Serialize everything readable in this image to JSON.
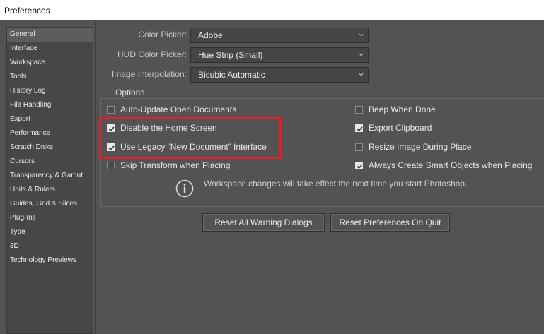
{
  "window": {
    "title": "Preferences"
  },
  "sidebar": {
    "items": [
      {
        "label": "General",
        "active": true
      },
      {
        "label": "Interface"
      },
      {
        "label": "Workspace"
      },
      {
        "label": "Tools"
      },
      {
        "label": "History Log"
      },
      {
        "label": "File Handling"
      },
      {
        "label": "Export"
      },
      {
        "label": "Performance"
      },
      {
        "label": "Scratch Disks"
      },
      {
        "label": "Cursors"
      },
      {
        "label": "Transparency & Gamut"
      },
      {
        "label": "Units & Rulers"
      },
      {
        "label": "Guides, Grid & Slices"
      },
      {
        "label": "Plug-Ins"
      },
      {
        "label": "Type"
      },
      {
        "label": "3D"
      },
      {
        "label": "Technology Previews"
      }
    ]
  },
  "general": {
    "color_picker": {
      "label": "Color Picker:",
      "value": "Adobe"
    },
    "hud_color_picker": {
      "label": "HUD Color Picker:",
      "value": "Hue Strip (Small)"
    },
    "image_interpolation": {
      "label": "Image Interpolation:",
      "value": "Bicubic Automatic"
    }
  },
  "options": {
    "legend": "Options",
    "left": [
      {
        "label": "Auto-Update Open Documents",
        "checked": false
      },
      {
        "label": "Disable the Home Screen",
        "checked": true
      },
      {
        "label": "Use Legacy “New Document” Interface",
        "checked": true
      },
      {
        "label": "Skip Transform when Placing",
        "checked": false
      }
    ],
    "right": [
      {
        "label": "Beep When Done",
        "checked": false
      },
      {
        "label": "Export Clipboard",
        "checked": true
      },
      {
        "label": "Resize Image During Place",
        "checked": false
      },
      {
        "label": "Always Create Smart Objects when Placing",
        "checked": true
      }
    ],
    "info_text": "Workspace changes will take effect the next time you start Photoshop."
  },
  "buttons": {
    "reset_warning": "Reset All Warning Dialogs",
    "reset_prefs": "Reset Preferences On Quit"
  },
  "colors": {
    "panel": "#535353",
    "highlight": "#e0202a"
  }
}
